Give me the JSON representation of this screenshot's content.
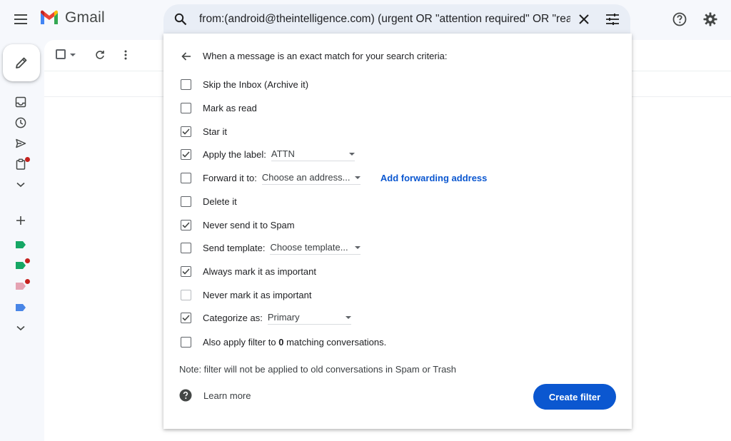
{
  "app": {
    "name": "Gmail",
    "accent": "#0b57d0"
  },
  "header": {
    "search_query": "from:(android@theintelligence.com) (urgent OR \"attention required\" OR \"read t",
    "icons": [
      "menu-icon",
      "search-icon",
      "close-icon",
      "tune-icon",
      "help-icon",
      "gear-icon"
    ]
  },
  "rail": {
    "icons": [
      "pencil-icon",
      "inbox-icon",
      "clock-icon",
      "send-icon",
      "clipboard-icon",
      "chevron-down-icon",
      "plus-icon",
      "label-icon",
      "label-icon",
      "label-icon",
      "label-icon",
      "chevron-down-icon"
    ],
    "label_colors": [
      "#16a765",
      "#16a765",
      "#e07798",
      "#4986e7"
    ]
  },
  "filter": {
    "heading": "When a message is an exact match for your search criteria:",
    "options": [
      {
        "label": "Skip the Inbox (Archive it)",
        "checked": false
      },
      {
        "label": "Mark as read",
        "checked": false
      },
      {
        "label": "Star it",
        "checked": true
      },
      {
        "label": "Apply the label:",
        "checked": true,
        "dropdown": "ATTN"
      },
      {
        "label": "Forward it to:",
        "checked": false,
        "dropdown": "Choose an address...",
        "link": "Add forwarding address"
      },
      {
        "label": "Delete it",
        "checked": false
      },
      {
        "label": "Never send it to Spam",
        "checked": true
      },
      {
        "label": "Send template:",
        "checked": false,
        "dropdown": "Choose template..."
      },
      {
        "label": "Always mark it as important",
        "checked": true
      },
      {
        "label": "Never mark it as important",
        "checked": false,
        "disabled": true
      },
      {
        "label": "Categorize as:",
        "checked": true,
        "dropdown": "Primary"
      },
      {
        "label_prefix": "Also apply filter to ",
        "count": "0",
        "label_suffix": " matching conversations.",
        "checked": false
      }
    ],
    "note": "Note: filter will not be applied to old conversations in Spam or Trash",
    "learn_more": "Learn more",
    "create_button": "Create filter"
  }
}
